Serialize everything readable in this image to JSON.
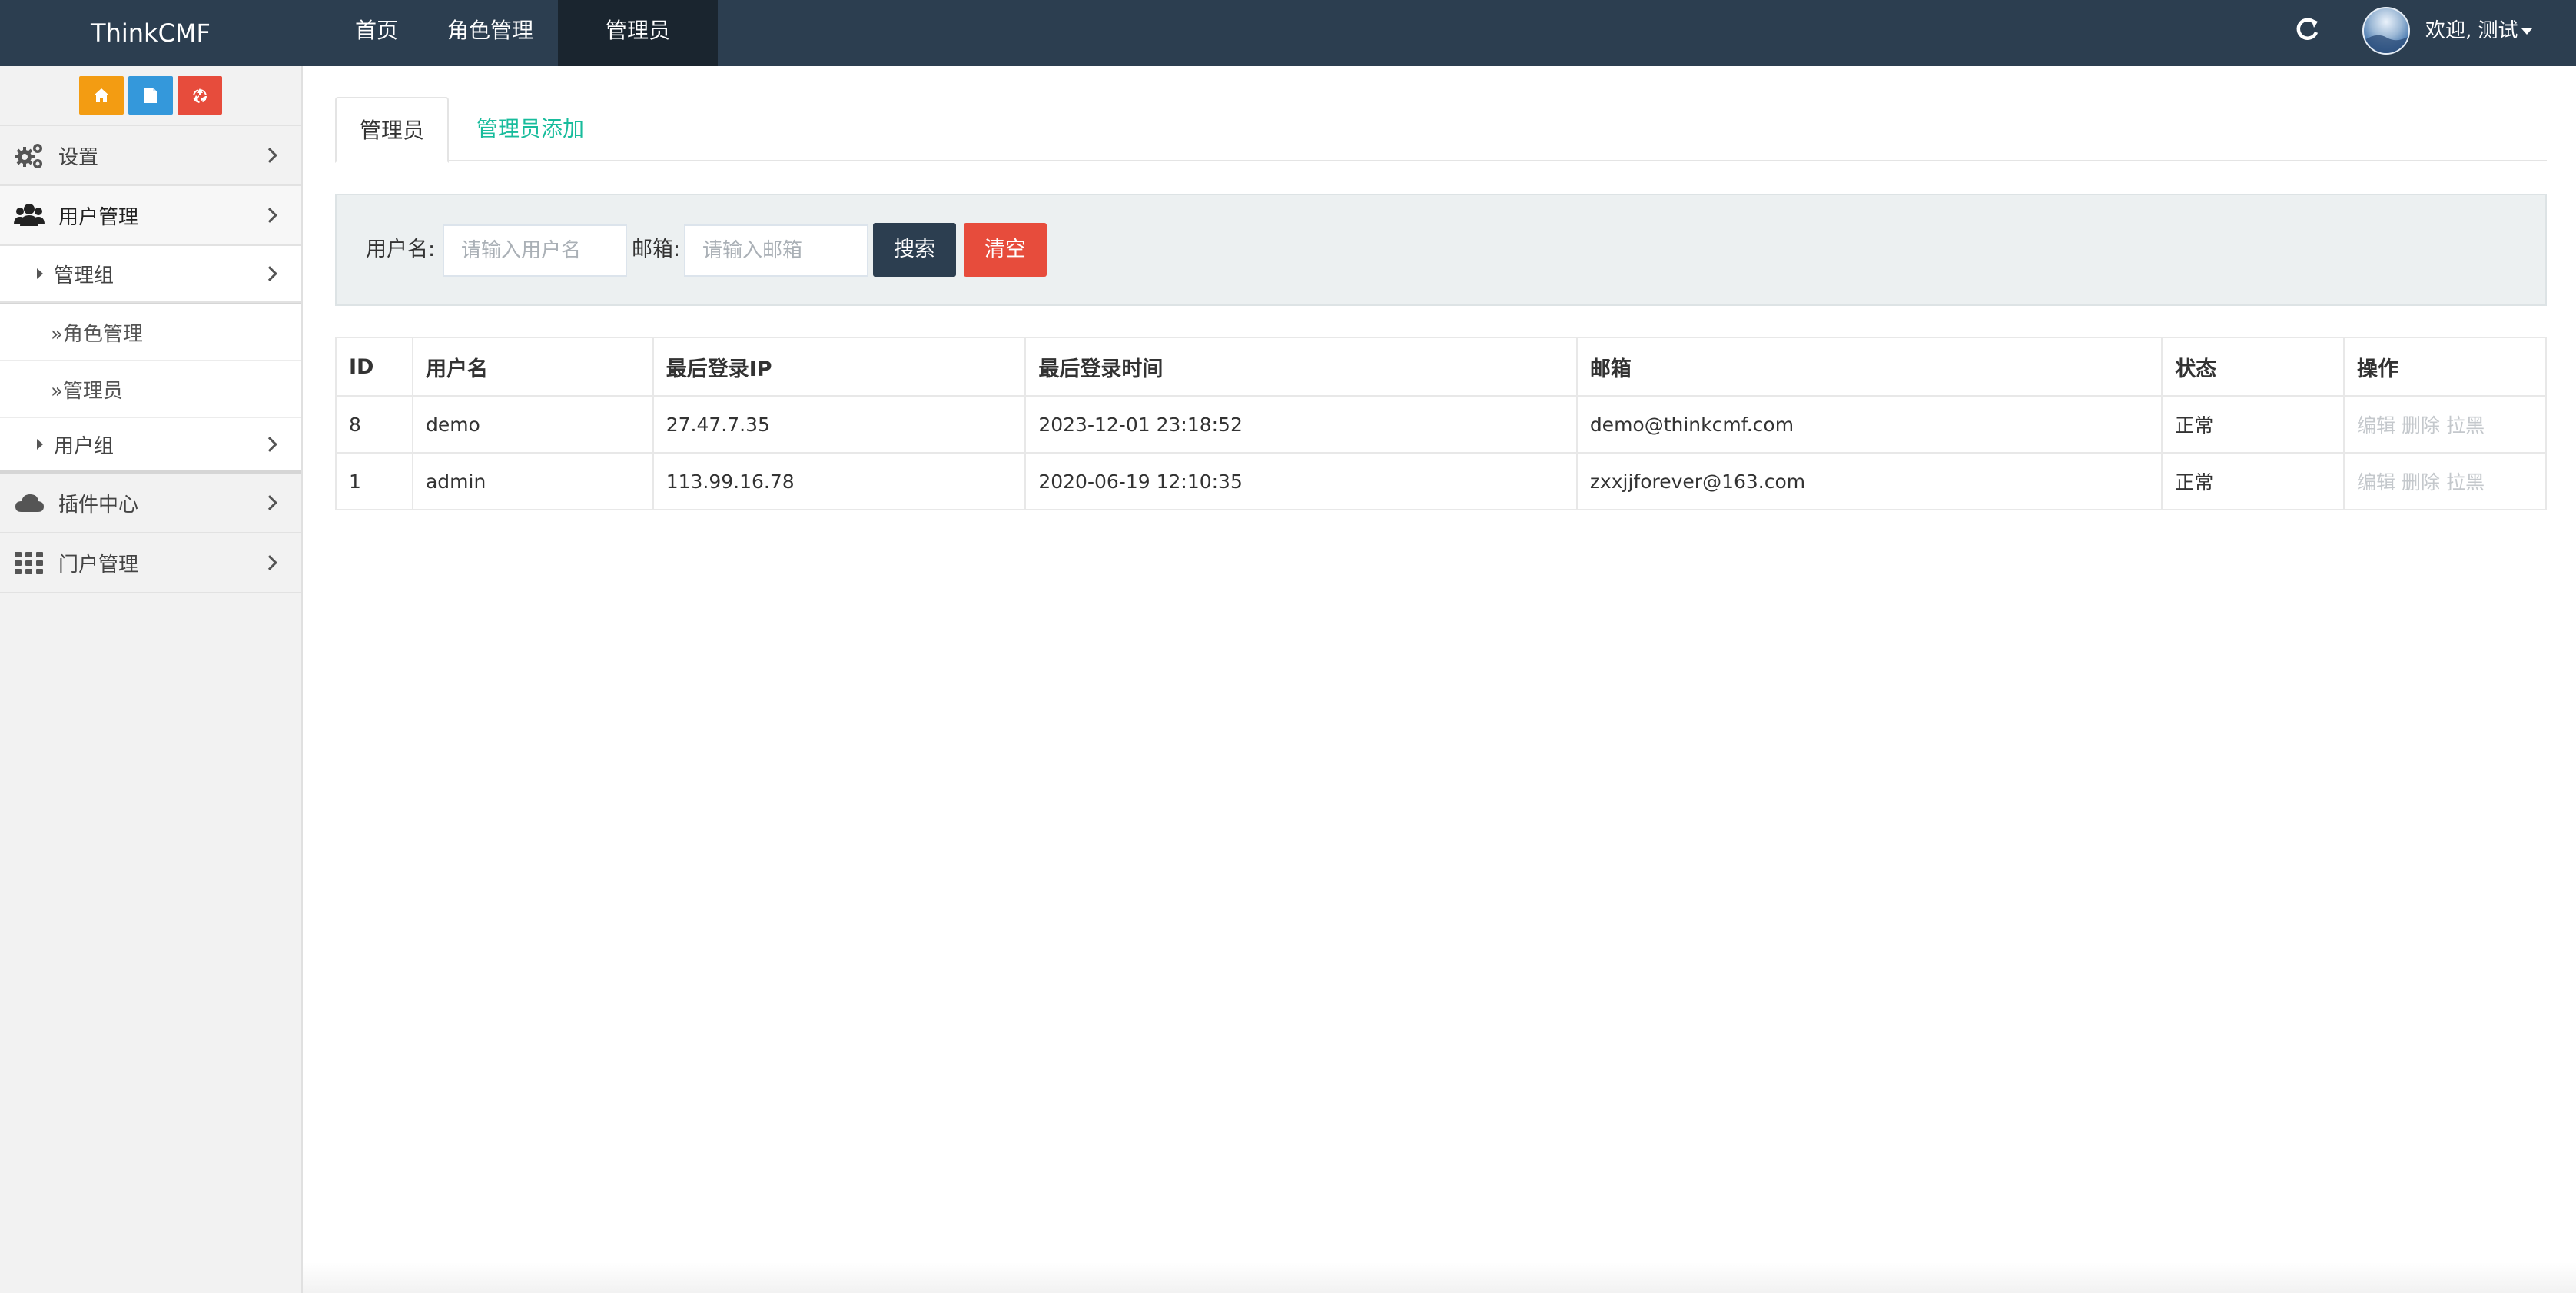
{
  "app": {
    "brand": "ThinkCMF"
  },
  "nav": {
    "items": [
      {
        "label": "首页"
      },
      {
        "label": "角色管理"
      },
      {
        "label": "管理员"
      }
    ],
    "active_index": 2,
    "welcome": "欢迎, 测试"
  },
  "sidebar": {
    "shortcuts": [
      {
        "icon": "home-icon",
        "color": "#f39c12"
      },
      {
        "icon": "file-icon",
        "color": "#3498db"
      },
      {
        "icon": "recycle-icon",
        "color": "#e74c3c"
      }
    ],
    "menu": [
      {
        "label": "设置",
        "icon": "cogs-icon"
      },
      {
        "label": "用户管理",
        "icon": "users-icon",
        "open": true
      },
      {
        "label": "插件中心",
        "icon": "cloud-icon"
      },
      {
        "label": "门户管理",
        "icon": "grid-icon"
      }
    ],
    "user_mgmt_children": {
      "admin_group": "管理组",
      "role_mgmt": "»角色管理",
      "admin": "»管理员",
      "user_group": "用户组"
    }
  },
  "tabs": {
    "active": "管理员",
    "add": "管理员添加"
  },
  "search": {
    "username_label": "用户名:",
    "username_placeholder": "请输入用户名",
    "email_label": "邮箱:",
    "email_placeholder": "请输入邮箱",
    "search_label": "搜索",
    "clear_label": "清空"
  },
  "table": {
    "headers": [
      "ID",
      "用户名",
      "最后登录IP",
      "最后登录时间",
      "邮箱",
      "状态",
      "操作"
    ],
    "rows": [
      {
        "id": "8",
        "username": "demo",
        "ip": "27.47.7.35",
        "time": "2023-12-01 23:18:52",
        "email": "demo@thinkcmf.com",
        "status": "正常",
        "actions": [
          "编辑",
          "删除",
          "拉黑"
        ]
      },
      {
        "id": "1",
        "username": "admin",
        "ip": "113.99.16.78",
        "time": "2020-06-19 12:10:35",
        "email": "zxxjjforever@163.com",
        "status": "正常",
        "actions": [
          "编辑",
          "删除",
          "拉黑"
        ]
      }
    ]
  },
  "colors": {
    "navbar": "#2c3e50",
    "navbar_active": "#1a252f",
    "accent_green": "#18bc9c",
    "danger": "#e74c3c",
    "muted_action": "#c4c8cc"
  }
}
